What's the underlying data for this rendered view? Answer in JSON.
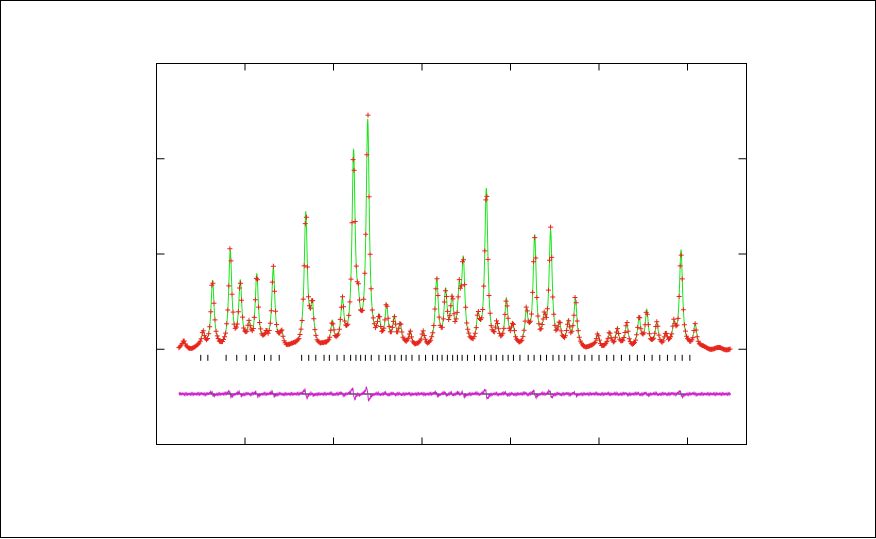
{
  "chart_data": {
    "type": "line",
    "title": "",
    "xlabel": "",
    "ylabel": "",
    "xlim": [
      0,
      100
    ],
    "ylim": [
      -1,
      3.0
    ],
    "grid": false,
    "legend": "none",
    "tick_labels": {
      "x": [],
      "y": []
    },
    "x_major_ticks": [
      15,
      30,
      45,
      60,
      75,
      90
    ],
    "y_major_ticks": [
      0,
      1,
      2,
      3
    ],
    "series": [
      {
        "role": "observed",
        "color": "#e8231a",
        "marker": "plus",
        "values": []
      },
      {
        "role": "calculated",
        "color": "#19e619"
      },
      {
        "role": "difference",
        "color": "#cc22cc",
        "offset": -0.47
      },
      {
        "role": "zero-line",
        "color": "#000000"
      }
    ],
    "peaks": [
      [
        4.6,
        0.07
      ],
      [
        7.9,
        0.16
      ],
      [
        9.5,
        0.7
      ],
      [
        12.5,
        1.0
      ],
      [
        14.2,
        0.67
      ],
      [
        15.7,
        0.2
      ],
      [
        17.0,
        0.75
      ],
      [
        18.6,
        0.1
      ],
      [
        19.8,
        0.82
      ],
      [
        21.2,
        0.14
      ],
      [
        25.3,
        1.4
      ],
      [
        26.4,
        0.4
      ],
      [
        29.8,
        0.25
      ],
      [
        31.5,
        0.45
      ],
      [
        33.4,
        2.0
      ],
      [
        34.2,
        0.28
      ],
      [
        35.8,
        2.35
      ],
      [
        37.7,
        0.26
      ],
      [
        39.0,
        0.4
      ],
      [
        40.3,
        0.28
      ],
      [
        41.3,
        0.22
      ],
      [
        43.0,
        0.16
      ],
      [
        45.2,
        0.15
      ],
      [
        47.5,
        0.7
      ],
      [
        49.0,
        0.55
      ],
      [
        50.1,
        0.45
      ],
      [
        51.3,
        0.5
      ],
      [
        52.0,
        0.85
      ],
      [
        54.5,
        0.28
      ],
      [
        55.9,
        1.65
      ],
      [
        57.7,
        0.2
      ],
      [
        59.3,
        0.48
      ],
      [
        60.4,
        0.2
      ],
      [
        62.7,
        0.35
      ],
      [
        64.1,
        1.15
      ],
      [
        65.7,
        0.22
      ],
      [
        66.8,
        1.2
      ],
      [
        68.3,
        0.2
      ],
      [
        69.8,
        0.25
      ],
      [
        71.0,
        0.5
      ],
      [
        74.8,
        0.15
      ],
      [
        76.8,
        0.14
      ],
      [
        78.1,
        0.2
      ],
      [
        79.7,
        0.25
      ],
      [
        81.8,
        0.3
      ],
      [
        83.1,
        0.38
      ],
      [
        84.8,
        0.25
      ],
      [
        86.3,
        0.14
      ],
      [
        87.7,
        0.22
      ],
      [
        88.9,
        1.02
      ],
      [
        91.3,
        0.25
      ]
    ],
    "reflection_ticks": [
      7.5,
      8.7,
      11.8,
      13.6,
      15.2,
      16.6,
      18.3,
      19.4,
      20.8,
      24.6,
      25.8,
      27.0,
      28.4,
      29.3,
      30.6,
      31.8,
      32.9,
      33.8,
      34.6,
      35.4,
      36.4,
      37.7,
      38.8,
      39.6,
      40.4,
      41.5,
      42.3,
      43.3,
      44.5,
      45.6,
      46.8,
      47.6,
      48.4,
      49.3,
      50.2,
      51.0,
      51.8,
      52.7,
      53.9,
      54.9,
      55.8,
      56.7,
      57.6,
      58.7,
      59.6,
      60.5,
      61.6,
      63.0,
      64.0,
      65.1,
      66.1,
      67.2,
      68.2,
      69.2,
      70.4,
      71.6,
      72.6,
      73.8,
      75.0,
      76.3,
      77.5,
      78.8,
      80.2,
      81.5,
      82.7,
      84.0,
      85.3,
      86.6,
      87.9,
      89.1,
      90.4
    ]
  }
}
